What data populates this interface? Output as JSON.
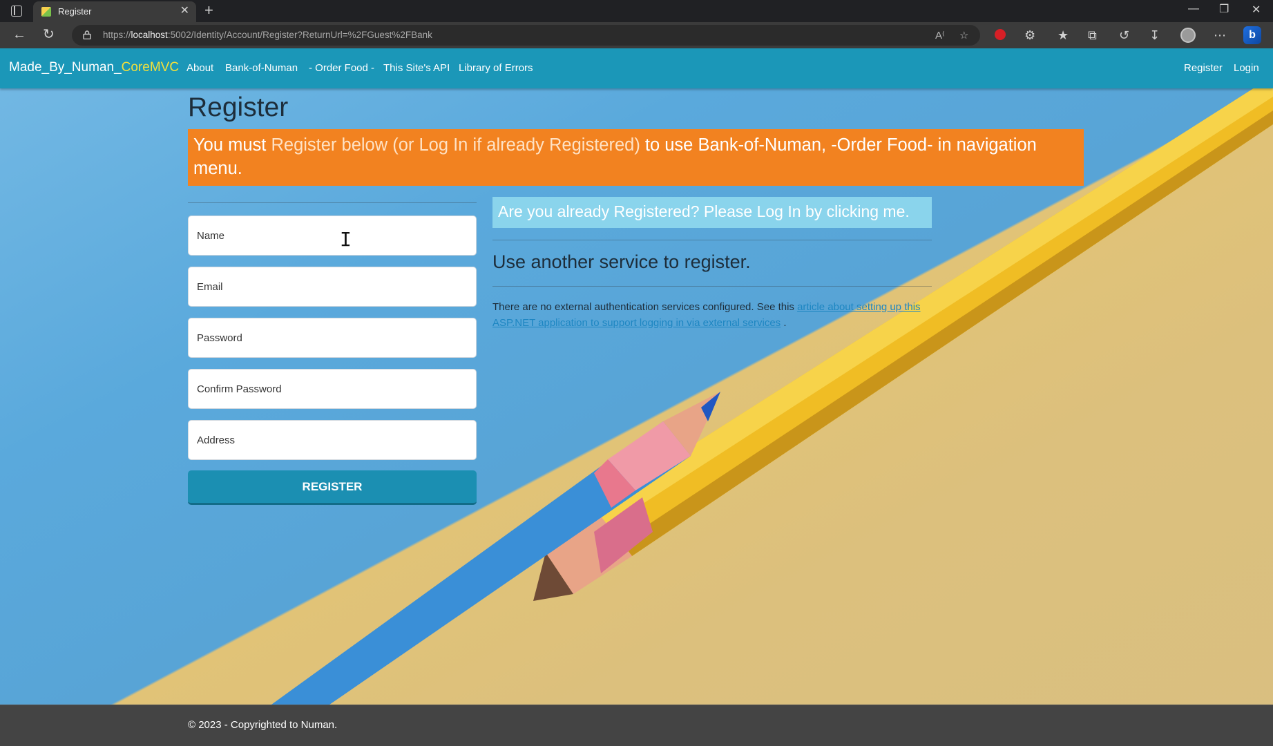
{
  "browser": {
    "tab_title": "Register",
    "close_glyph": "✕",
    "new_tab_glyph": "+",
    "url_prefix": "https://",
    "url_host": "localhost",
    "url_rest": ":5002/Identity/Account/Register?ReturnUrl=%2FGuest%2FBank",
    "profile_initial": "",
    "bing_glyph": "b"
  },
  "navbar": {
    "brand_main": "Made_By_Numan_",
    "brand_accent": "CoreMVC",
    "links": [
      "About",
      "Bank-of-Numan",
      "- Order Food -",
      "This Site's API",
      "Library of Errors"
    ],
    "right_links": [
      "Register",
      "Login"
    ]
  },
  "page": {
    "title": "Register",
    "warning_lead": "You must ",
    "warning_muted": "Register below (or Log In if already Registered)",
    "warning_tail": " to use Bank-of-Numan, -Order Food- in navigation menu.",
    "placeholders": {
      "name": "Name",
      "email": "Email",
      "password": "Password",
      "confirm": "Confirm Password",
      "address": "Address"
    },
    "register_button": "REGISTER",
    "login_prompt": "Are you already Registered? Please Log In by clicking me.",
    "other_service_heading": "Use another service to register.",
    "ext_note_text": "There are no external authentication services configured. See this ",
    "ext_note_link": "article about setting up this ASP.NET application to support logging in via external services",
    "ext_note_end": "."
  },
  "footer": {
    "text": "© 2023 - Copyrighted to Numan."
  },
  "colors": {
    "navbar": "#1b97b8",
    "brand_accent": "#f4e03a",
    "warning": "#f28220",
    "login_prompt_bg": "#8ad4ec",
    "button": "#1b8fb2",
    "footer": "#444444"
  }
}
